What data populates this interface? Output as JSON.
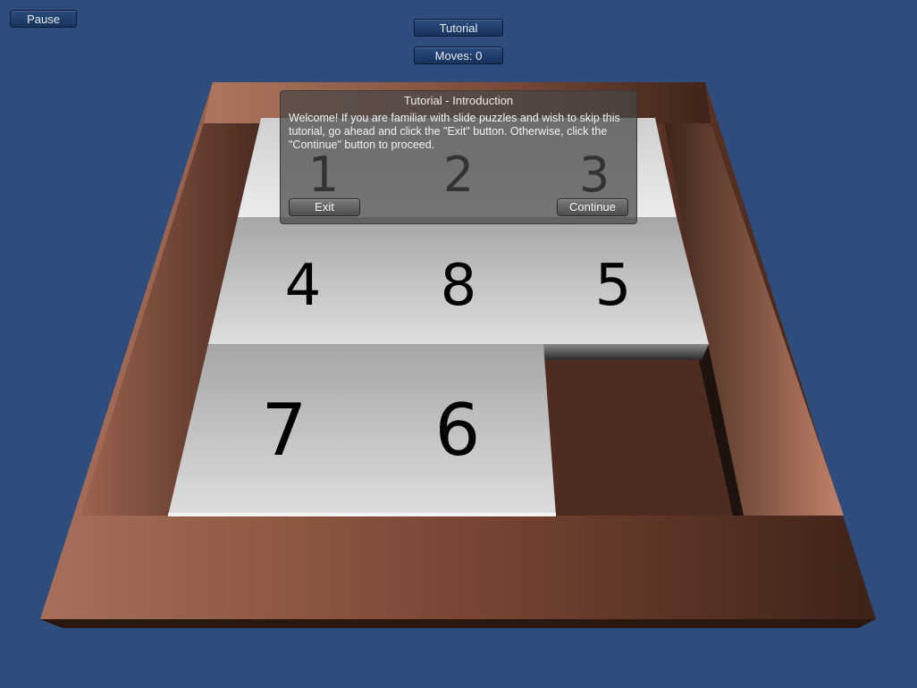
{
  "hud": {
    "pause_label": "Pause",
    "tutorial_label": "Tutorial",
    "moves_label": "Moves: 0"
  },
  "tutorial": {
    "title": "Tutorial - Introduction",
    "body": "Welcome! If you are familiar with slide puzzles and wish to skip this tutorial, go ahead and click the \"Exit\" button. Otherwise, click the \"Continue\" button to proceed.",
    "exit_label": "Exit",
    "continue_label": "Continue"
  },
  "board": {
    "tiles": [
      "1",
      "2",
      "3",
      "4",
      "8",
      "5",
      "7",
      "6"
    ],
    "empty_slot": "bottom-right"
  },
  "colors": {
    "background": "#2e4d7c",
    "frame": "#8a5040",
    "tile": "#d4d4d4"
  }
}
